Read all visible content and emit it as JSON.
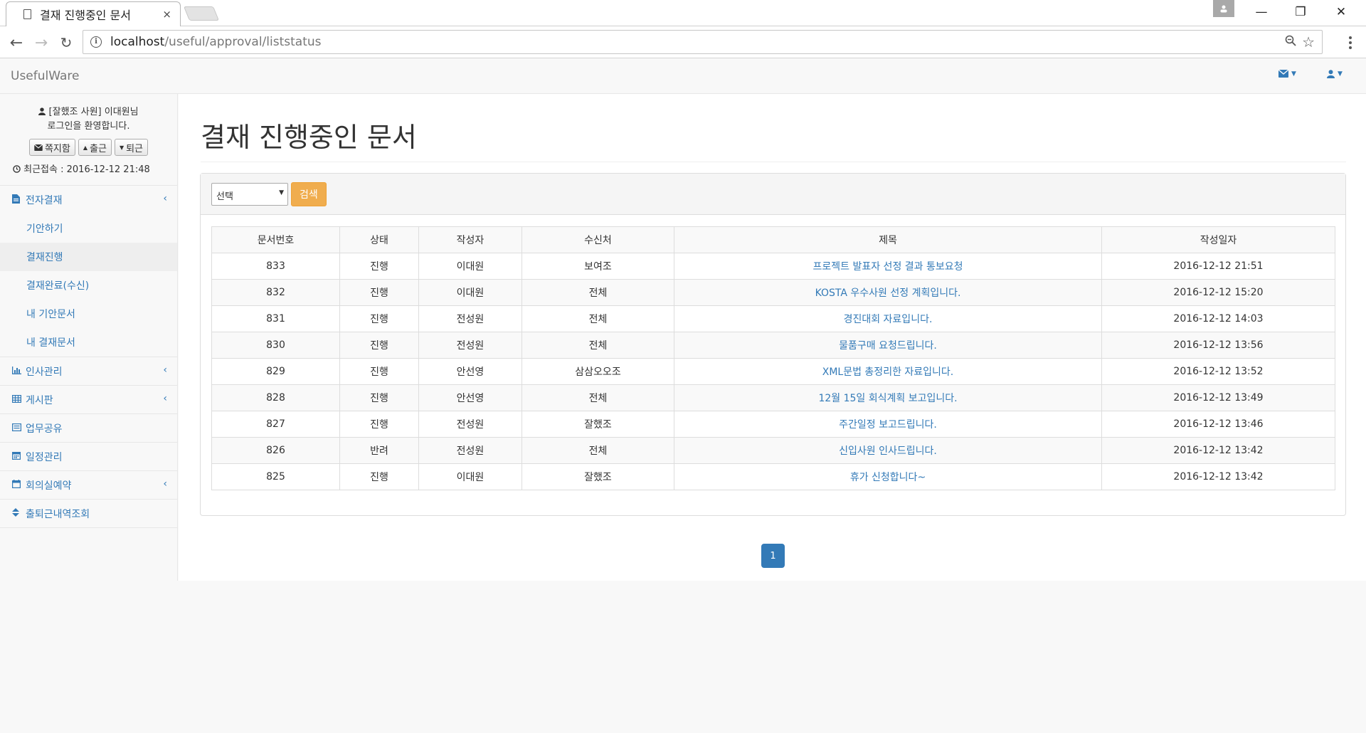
{
  "browser": {
    "tab_title": "결재 진행중인 문서",
    "tab_close": "×",
    "url_host": "localhost",
    "url_path": "/useful/approval/liststatus",
    "window_controls": [
      "—",
      "❐",
      "✕"
    ]
  },
  "navbar": {
    "brand": "UsefulWare",
    "icons": [
      "envelope-icon",
      "user-icon"
    ]
  },
  "sidebar": {
    "welcome_line1": "[잘했조 사원] 이대원님",
    "welcome_line2": "로그인을 환영합니다.",
    "buttons": {
      "message": "쪽지함",
      "checkin": "출근",
      "checkout": "퇴근"
    },
    "last_login": "최근접속 : 2016-12-12 21:48",
    "menu": [
      {
        "label": "전자결재",
        "icon": "file-icon",
        "has_children": true
      },
      {
        "label": "인사관리",
        "icon": "bar-chart-icon",
        "has_children": true
      },
      {
        "label": "게시판",
        "icon": "table-icon",
        "has_children": true
      },
      {
        "label": "업무공유",
        "icon": "list-icon",
        "has_children": false
      },
      {
        "label": "일정관리",
        "icon": "calendar-icon",
        "has_children": false
      },
      {
        "label": "회의실예약",
        "icon": "calendar-icon",
        "has_children": true
      },
      {
        "label": "출퇴근내역조회",
        "icon": "sort-icon",
        "has_children": false
      }
    ],
    "submenu": [
      {
        "label": "기안하기",
        "active": false
      },
      {
        "label": "결재진행",
        "active": true
      },
      {
        "label": "결재완료(수신)",
        "active": false
      },
      {
        "label": "내 기안문서",
        "active": false
      },
      {
        "label": "내 결재문서",
        "active": false
      }
    ]
  },
  "main": {
    "page_title": "결재 진행중인 문서",
    "filter": {
      "selected": "선택",
      "search_label": "검색"
    },
    "table": {
      "headers": [
        "문서번호",
        "상태",
        "작성자",
        "수신처",
        "제목",
        "작성일자"
      ],
      "rows": [
        [
          "833",
          "진행",
          "이대원",
          "보여조",
          "프로젝트 발표자 선정 결과 통보요청",
          "2016-12-12 21:51"
        ],
        [
          "832",
          "진행",
          "이대원",
          "전체",
          "KOSTA 우수사원 선정 계획입니다.",
          "2016-12-12 15:20"
        ],
        [
          "831",
          "진행",
          "전성원",
          "전체",
          "경진대회 자료입니다.",
          "2016-12-12 14:03"
        ],
        [
          "830",
          "진행",
          "전성원",
          "전체",
          "물품구매 요청드립니다.",
          "2016-12-12 13:56"
        ],
        [
          "829",
          "진행",
          "안선영",
          "삼삼오오조",
          "XML문법 총정리한 자료입니다.",
          "2016-12-12 13:52"
        ],
        [
          "828",
          "진행",
          "안선영",
          "전체",
          "12월 15일 회식계획 보고입니다.",
          "2016-12-12 13:49"
        ],
        [
          "827",
          "진행",
          "전성원",
          "잘했조",
          "주간일정 보고드립니다.",
          "2016-12-12 13:46"
        ],
        [
          "826",
          "반려",
          "전성원",
          "전체",
          "신입사원 인사드립니다.",
          "2016-12-12 13:42"
        ],
        [
          "825",
          "진행",
          "이대원",
          "잘했조",
          "휴가 신청합니다~",
          "2016-12-12 13:42"
        ]
      ]
    },
    "pagination": {
      "current": "1"
    }
  },
  "colors": {
    "link": "#337ab7",
    "warning": "#f0ad4e",
    "primary": "#337ab7"
  }
}
